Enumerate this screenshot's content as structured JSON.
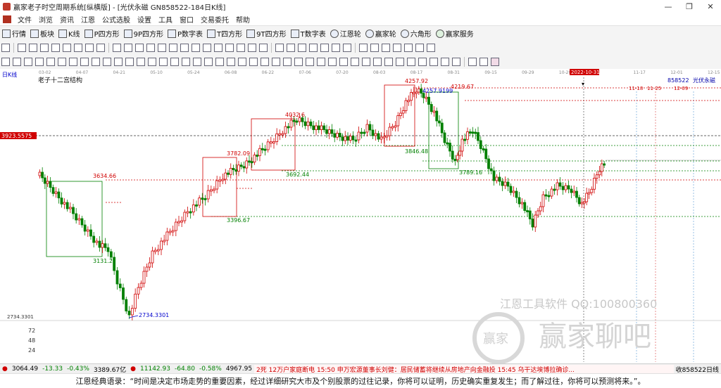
{
  "window": {
    "title": "赢家老子时空周期系统[纵横版] - [光伏永磁  GN858522-184日K线]",
    "controls": [
      "—",
      "❐",
      "✕"
    ]
  },
  "menu": {
    "items": [
      "文件",
      "浏览",
      "资讯",
      "江恩",
      "公式选股",
      "设置",
      "工具",
      "窗口",
      "交易委托",
      "帮助"
    ],
    "mdi_controls": [
      "—",
      "❐",
      "✕"
    ]
  },
  "toolbar1": {
    "items": [
      "行情",
      "板块",
      "K线",
      "P四方形",
      "9P四方形",
      "P数字表",
      "T四方形",
      "9T四方形",
      "T数字表",
      "江恩轮",
      "赢家轮",
      "六角形",
      "赢家服务"
    ]
  },
  "chart": {
    "period_label": "日K线",
    "indicator_title": "老子十二宫结构",
    "right_label_code": "858522",
    "right_label_name": "光伏永磁",
    "highlight_date": "2022-10-31",
    "future_dates": [
      "11-18",
      "11-25",
      "12-09"
    ],
    "current_price_tag": "3923.5575",
    "low_tag": "2734.3301",
    "vol_ticks": [
      "72",
      "48",
      "24"
    ],
    "watermark_line1": "江恩工具软件  QQ:100800360",
    "watermark_line2": "赢家聊吧",
    "watermark_logo": "赢家",
    "date_axis": [
      "03-02",
      "04-07",
      "04-21",
      "05-10",
      "05-24",
      "06-08",
      "06-22",
      "07-06",
      "07-20",
      "08-03",
      "08-17",
      "08-31",
      "09-15",
      "09-29",
      "10-20",
      "10-31",
      "11-17",
      "12-01",
      "12-15"
    ],
    "price_labels": [
      "3634.66",
      "3131.2",
      "2734.3301",
      "3782.09",
      "3396.67",
      "4032.6",
      "3692.44",
      "4257.92",
      "3846.48",
      "4219.67",
      "4257.9199",
      "3789.16"
    ]
  },
  "chart_data": {
    "type": "candlestick",
    "title": "老子十二宫结构",
    "symbol": "GN858522 光伏永磁",
    "period": "日K线",
    "x_axis": [
      "03-02",
      "04-07",
      "04-21",
      "05-10",
      "05-24",
      "06-08",
      "06-22",
      "07-06",
      "07-20",
      "08-03",
      "08-17",
      "08-31",
      "09-15",
      "09-29",
      "10-20",
      "10-31",
      "11-17",
      "12-01",
      "12-15"
    ],
    "key_levels": [
      3634.66,
      3131.2,
      2734.3301,
      3782.09,
      3396.67,
      4032.6,
      3692.44,
      4257.92,
      3846.48,
      4219.67,
      4257.9199,
      3789.16,
      3923.5575
    ],
    "low": 2734.3301,
    "high": 4257.92,
    "current": 3923.5575
  },
  "statusbar": {
    "idx1": "3064.49",
    "chg1": "-13.33",
    "pct1": "-0.43%",
    "v1": "3389.67亿",
    "idx2": "11142.93",
    "chg2": "-64.80",
    "pct2": "-0.58%",
    "v2": "4967.95",
    "news": "2死 12万户家庭断电   15:50 申万宏源董事长刘健：居民储蓄将继续从房地产向金融投   15:45 乌干达埃博拉确诊...",
    "right": "收858522日线"
  },
  "quote": {
    "text": "江恩经典语录：“时间是决定市场走势的重要因素，经过详细研究大市及个别股票的过往记录，你将可以证明，历史确实重复发生；而了解过往，你将可以预测将来。”。"
  },
  "colors": {
    "up": "#d00000",
    "down": "#008000",
    "bg": "#ffffff",
    "highlight": "#d00000"
  }
}
